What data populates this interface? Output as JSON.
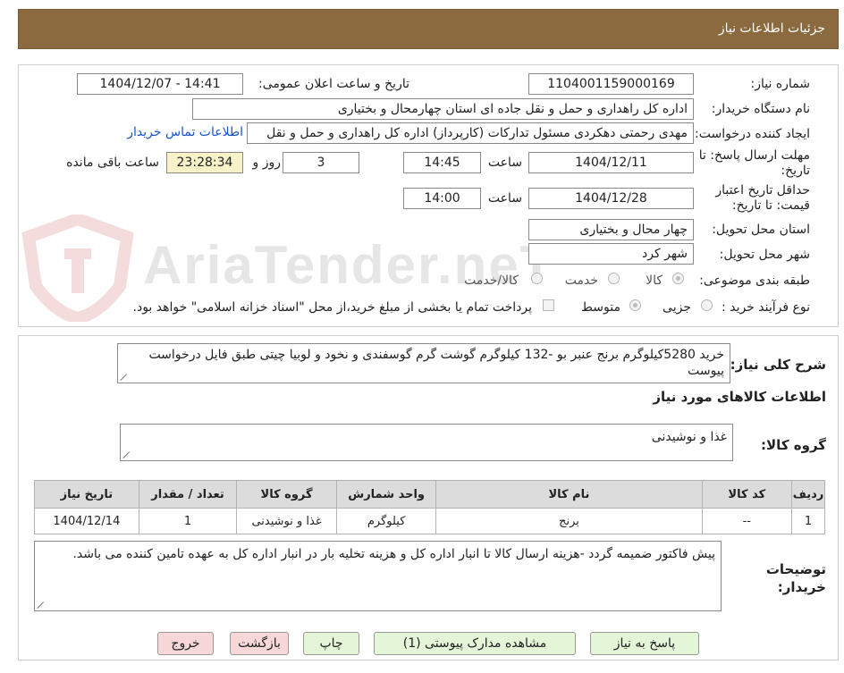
{
  "header": {
    "title": "جزئیات اطلاعات نیاز"
  },
  "watermark": {
    "text": "AriaTender.neT"
  },
  "need": {
    "number_label": "شماره نیاز:",
    "number": "1104001159000169",
    "announce_label": "تاریخ و ساعت اعلان عمومی:",
    "announce_value": "1404/12/07 - 14:41",
    "buyer_org_label": "نام دستگاه خریدار:",
    "buyer_org": "اداره کل راهداری و حمل و نقل جاده ای استان چهارمحال و بختیاری",
    "creator_label": "ایجاد کننده درخواست:",
    "creator": "مهدی رحمتی دهکردی مسئول تدارکات (کارپرداز) اداره کل راهداری و حمل و نقل",
    "contact_link": "اطلاعات تماس خریدار",
    "deadline_label": "مهلت ارسال پاسخ: تا تاریخ:",
    "deadline_date": "1404/12/11",
    "time_label": "ساعت",
    "deadline_time": "14:45",
    "days": "3",
    "day_and_label": "روز و",
    "remaining_time": "23:28:34",
    "remaining_label": "ساعت باقی مانده",
    "validity_label": "حداقل تاریخ اعتبار قیمت: تا تاریخ:",
    "validity_date": "1404/12/28",
    "validity_time": "14:00",
    "province_label": "استان محل تحویل:",
    "province": "چهار محال و بختیاری",
    "city_label": "شهر محل تحویل:",
    "city": "شهر کرد",
    "category_label": "طبقه بندی موضوعی:",
    "category_options": [
      "کالا",
      "خدمت",
      "کالا/خدمت"
    ],
    "process_label": "نوع فرآیند خرید :",
    "process_options": [
      "جزیی",
      "متوسط"
    ],
    "payment_note": "پرداخت تمام یا بخشی از مبلغ خرید،از محل \"اسناد خزانه اسلامی\" خواهد بود."
  },
  "details": {
    "summary_label": "شرح کلی نیاز:",
    "summary": "خرید 5280کیلوگرم برنج عنبر بو -132 کیلوگرم گوشت گرم گوسفندی و نخود و لوبیا چیتی طبق فایل درخواست پیوست",
    "goods_info_title": "اطلاعات کالاهای مورد نیاز",
    "goods_group_label": "گروه کالا:",
    "goods_group": "غذا و نوشیدنی",
    "table": {
      "headers": [
        "ردیف",
        "کد کالا",
        "نام کالا",
        "واحد شمارش",
        "گروه کالا",
        "تعداد / مقدار",
        "تاریخ نیاز"
      ],
      "rows": [
        [
          "1",
          "--",
          "برنج",
          "کیلوگرم",
          "غذا و نوشیدنی",
          "1",
          "1404/12/14"
        ]
      ]
    },
    "buyer_notes_label": "توضیحات خریدار:",
    "buyer_notes": "پیش فاکتور ضمیمه گردد -هزینه ارسال کالا تا انبار اداره کل و هزینه تخلیه بار در انبار اداره کل به عهده تامین کننده می باشد."
  },
  "buttons": {
    "reply": "پاسخ به نیاز",
    "attachments": "مشاهده مدارک پیوستی (1)",
    "print": "چاپ",
    "back": "بازگشت",
    "exit": "خروج"
  },
  "colors": {
    "header_bg": "#8c6a3f",
    "timer_bg": "#f7f2c8",
    "link": "#1a55c5",
    "btn_green": "#e4f5d8",
    "btn_pink": "#f7d7d7"
  }
}
